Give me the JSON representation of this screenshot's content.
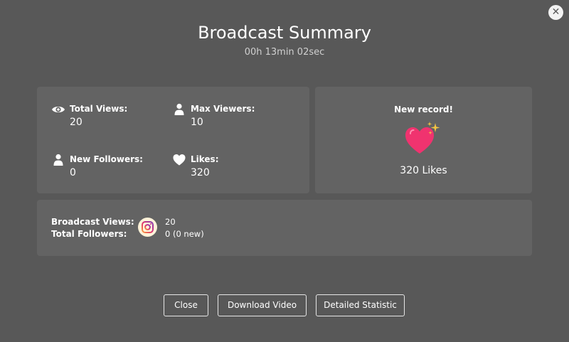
{
  "dialog": {
    "title": "Broadcast Summary",
    "duration": "00h 13min 02sec",
    "close_icon": "close-icon"
  },
  "stats": {
    "total_views": {
      "label": "Total Views:",
      "value": "20",
      "icon": "eye-icon"
    },
    "max_viewers": {
      "label": "Max Viewers:",
      "value": "10",
      "icon": "person-icon"
    },
    "new_followers": {
      "label": "New Followers:",
      "value": "0",
      "icon": "person-icon"
    },
    "likes": {
      "label": "Likes:",
      "value": "320",
      "icon": "heart-icon"
    }
  },
  "record": {
    "title": "New record!",
    "likes_text": "320 Likes",
    "icon": "sparkling-heart-icon",
    "heart_color": "#f0336f",
    "sparkle_color": "#f5c542"
  },
  "social": {
    "labels": {
      "broadcast_views": "Broadcast Views:",
      "total_followers": "Total Followers:"
    },
    "platform_icon": "instagram-icon",
    "values": {
      "broadcast_views": "20",
      "total_followers": "0 (0 new)"
    }
  },
  "buttons": {
    "close": "Close",
    "download": "Download Video",
    "detailed": "Detailed Statistic"
  },
  "colors": {
    "background": "#585858",
    "panel": "#636363",
    "text": "#ffffff"
  }
}
